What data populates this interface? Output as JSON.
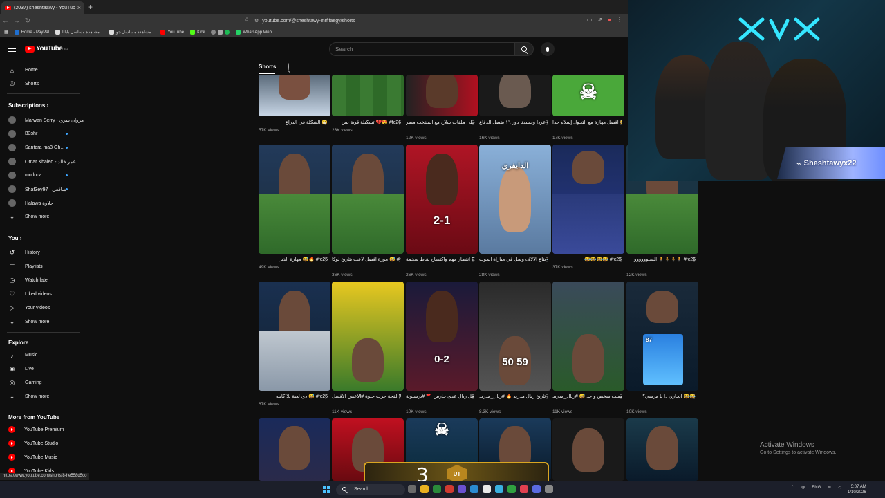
{
  "browser": {
    "tab_title": "(2037) sheshtaawy - YouTube",
    "tab_close": "×",
    "new_tab": "+",
    "url": "youtube.com/@sheshtawy-mrfifaegy/shorts",
    "bookmarks": [
      "Home - PayPal",
      "مشاهدة مسلسل بابا ا...",
      "مشاهدة مسلسل جو...",
      "YouTube",
      "Kick",
      "WhatsApp Web"
    ]
  },
  "header": {
    "logo_text": "YouTube",
    "logo_region": "EG",
    "search_placeholder": "Search"
  },
  "sidebar": {
    "main": [
      {
        "label": "Home",
        "icon": "home-icon"
      },
      {
        "label": "Shorts",
        "icon": "shorts-icon"
      }
    ],
    "subscriptions_title": "Subscriptions",
    "subscriptions": [
      {
        "label": "Marwan Serry - مروان سري"
      },
      {
        "label": "B3shr"
      },
      {
        "label": "Santara ma3 Gh..."
      },
      {
        "label": "Omar Khaled - عمر خالد"
      },
      {
        "label": "mo luca"
      },
      {
        "label": "Shaf3ey97 | شافعي"
      },
      {
        "label": "Halawa حلاوة"
      }
    ],
    "show_more": "Show more",
    "you_title": "You",
    "you_items": [
      {
        "label": "History",
        "icon": "history-icon"
      },
      {
        "label": "Playlists",
        "icon": "playlists-icon"
      },
      {
        "label": "Watch later",
        "icon": "watch-later-icon"
      },
      {
        "label": "Liked videos",
        "icon": "liked-icon"
      },
      {
        "label": "Your videos",
        "icon": "your-videos-icon"
      }
    ],
    "explore_title": "Explore",
    "explore_items": [
      {
        "label": "Music",
        "icon": "music-icon"
      },
      {
        "label": "Live",
        "icon": "live-icon"
      },
      {
        "label": "Gaming",
        "icon": "gaming-icon"
      }
    ],
    "more_title": "More from YouTube",
    "more_items": [
      {
        "label": "YouTube Premium"
      },
      {
        "label": "YouTube Studio"
      },
      {
        "label": "YouTube Music"
      },
      {
        "label": "YouTube Kids"
      }
    ]
  },
  "shorts_tab": "Shorts",
  "rows": [
    [
      {
        "title": "الشكلة في الدراع 😁",
        "views": "57K views"
      },
      {
        "title": "تشكيلة قوية بس 💔😍 #fc26",
        "views": "23K views"
      },
      {
        "title": "من أحلى ملفات سلاح مع المنتخب مصر EG #",
        "views": "12K views"
      },
      {
        "title": "عزدا وحسدنا دور ١٦ بفضل الدفاع #afcon EG",
        "views": "16K views"
      },
      {
        "title": "أفضل مهارة مع التحول إسلام جدا 😅 #fc26",
        "views": "17K views"
      }
    ],
    [
      {
        "title": "مهارة الذيل 😅🔥 #fc26",
        "views": "49K views"
      },
      {
        "title": "موزة افضل لاعب بتاريخ لوكا 😅 #fc26 🔥",
        "views": "36K views"
      },
      {
        "title": "انتصار مهم واكتساح نقاط ضخمة EG #afcon",
        "views": "26K views"
      },
      {
        "title": "بتاع الالاف وصل في مباراة الموت 😂😍 #fc26",
        "views": "28K views"
      },
      {
        "title": "😂😂😂😂 #fc26",
        "views": "37K views"
      },
      {
        "title": "السيوووووو 🧍🧍🧍🧍 #fc26",
        "views": "12K views"
      }
    ],
    [
      {
        "title": "دي لعبة بلا كابنه 😅 #fc26",
        "views": "67K views"
      },
      {
        "title": "بتاع ولا لقجة حرب حلوة #الاعبين الافضل 😅",
        "views": "11K views"
      },
      {
        "title": "عرضي قل ريال عدي حارس 🚩 #برشلونة",
        "views": "10K views"
      },
      {
        "title": "افضل لاعب في تاريخ ريال مدريد 🔥 #ريال_مدريد",
        "views": "8.3K views"
      },
      {
        "title": "غزدا بسبب شخص واحد 😅 #ريال_مدريد",
        "views": "11K views"
      },
      {
        "title": "انجازي دا يا مرسي؟ 😂😂",
        "views": "10K views"
      }
    ]
  ],
  "thumb_overlays": {
    "score_1": "2-1",
    "score_2": "0-2",
    "score_3": "50 59",
    "arabic_tag": "الدايفري",
    "ut_number": "3",
    "ut_badge": "UT",
    "card_rating": "87"
  },
  "streamer_name": "Sheshtawyx22",
  "activate": {
    "line1": "Activate Windows",
    "line2": "Go to Settings to activate Windows."
  },
  "status_url": "https://www.youtube.com/shorts/8-he558d5co",
  "taskbar": {
    "search": "Search",
    "lang": "ENG",
    "time": "5:07 AM",
    "date": "1/10/2026"
  },
  "colors": {
    "background": "#0f0f0f",
    "accent_red": "#ff0000",
    "subscription_dot": "#3ea6ff"
  }
}
